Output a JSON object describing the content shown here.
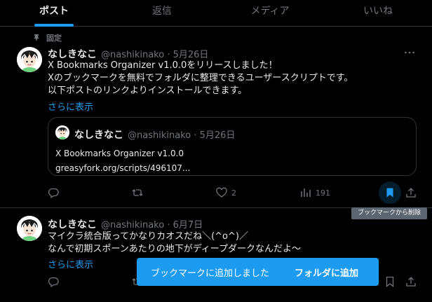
{
  "tabs": [
    {
      "label": "ポスト",
      "active": true
    },
    {
      "label": "返信"
    },
    {
      "label": "メディア"
    },
    {
      "label": "いいね"
    }
  ],
  "post1": {
    "pinned_label": "固定",
    "name": "なしきなこ",
    "handle_date": "@nashikinako · 5月26日",
    "lines": [
      "X Bookmarks Organizer v1.0.0をリリースしました！",
      "Xのブックマークを無料でフォルダに整理できるユーザースクリプトです。",
      "以下ポストのリンクよりインストールできます。"
    ],
    "show_more": "さらに表示",
    "quote": {
      "name": "なしきなこ",
      "handle_date": "@nashikinako · 5月26日",
      "line1": "X Bookmarks Organizer v1.0.0",
      "line2": "greasyfork.org/scripts/496107..."
    },
    "likes": "2",
    "views": "191"
  },
  "post2": {
    "name": "なしきなこ",
    "handle_date": "@nashikinako · 6月7日",
    "lines": [
      "マイクラ統合版ってかなりカオスだね＼(^o^)／",
      "なんで初期スポーンあたりの地下がディープダークなんだよ～"
    ],
    "show_more": "さらに表示"
  },
  "tooltip": "ブックマークから削除",
  "toast": {
    "message": "ブックマークに追加しました",
    "action": "フォルダに追加"
  },
  "colors": {
    "accent": "#1d9bf0",
    "muted": "#71767b",
    "border": "#2f3336",
    "bg": "#000000"
  }
}
